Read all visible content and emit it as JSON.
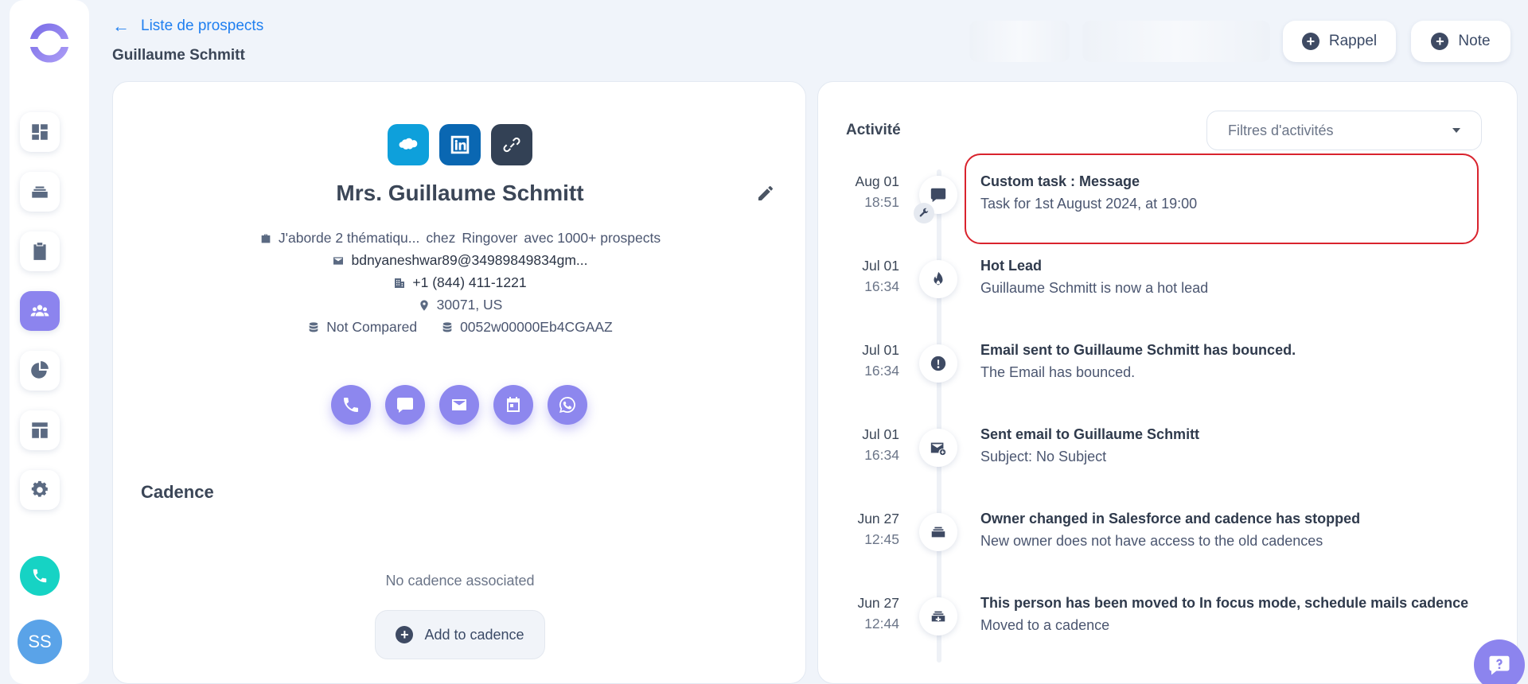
{
  "sidebar": {
    "avatar_initials": "SS",
    "icons": [
      "logo-icon",
      "dashboard-icon",
      "inbox-icon",
      "tasks-icon",
      "people-icon",
      "analytics-icon",
      "templates-icon",
      "settings-icon",
      "phone-icon"
    ],
    "active_item": "people-icon",
    "accent_color": "#8c84ee"
  },
  "header": {
    "back_label": "Liste de prospects",
    "title": "Guillaume Schmitt",
    "reminder_label": "Rappel",
    "note_label": "Note"
  },
  "prospect": {
    "name": "Mrs. Guillaume Schmitt",
    "job": "J'aborde 2 thématiqu...",
    "company_prefix": "chez",
    "company": "Ringover",
    "company_note": "avec 1000+ prospects",
    "email": "bdnyaneshwar89@34989849834gm...",
    "phone": "+1 (844) 411-1221",
    "location": "30071, US",
    "sync_status": "Not Compared",
    "crm_id": "0052w00000Eb4CGAAZ",
    "social_links": [
      "salesforce-icon",
      "linkedin-icon",
      "link-icon"
    ],
    "actions": [
      "call-icon",
      "sms-icon",
      "email-icon",
      "calendar-icon",
      "whatsapp-icon"
    ]
  },
  "cadence": {
    "title": "Cadence",
    "empty_text": "No cadence associated",
    "add_label": "Add to cadence"
  },
  "activity": {
    "title": "Activité",
    "filter_placeholder": "Filtres d'activités",
    "items": [
      {
        "date": "Aug 01",
        "time": "18:51",
        "title": "Custom task : Message",
        "desc": "Task for 1st August 2024, at 19:00",
        "icon": "chat-icon",
        "highlighted": true
      },
      {
        "date": "Jul 01",
        "time": "16:34",
        "title": "Hot Lead",
        "desc": "Guillaume Schmitt is now a hot lead",
        "icon": "flame-icon"
      },
      {
        "date": "Jul 01",
        "time": "16:34",
        "title": "Email sent to Guillaume Schmitt has bounced.",
        "desc": "The Email has bounced.",
        "icon": "alert-icon"
      },
      {
        "date": "Jul 01",
        "time": "16:34",
        "title": "Sent email to Guillaume Schmitt",
        "desc": "Subject: No Subject",
        "icon": "mail-sent-icon"
      },
      {
        "date": "Jun 27",
        "time": "12:45",
        "title": "Owner changed in Salesforce and cadence has stopped",
        "desc": "New owner does not have access to the old cadences",
        "icon": "stack-icon"
      },
      {
        "date": "Jun 27",
        "time": "12:44",
        "title": "This person has been moved to In focus mode, schedule mails cadence",
        "desc": "Moved to a cadence",
        "icon": "move-icon"
      }
    ]
  },
  "colors": {
    "link_blue": "#1f7ff0",
    "highlight_red": "#d9232d",
    "call_green": "#16d3c4"
  }
}
